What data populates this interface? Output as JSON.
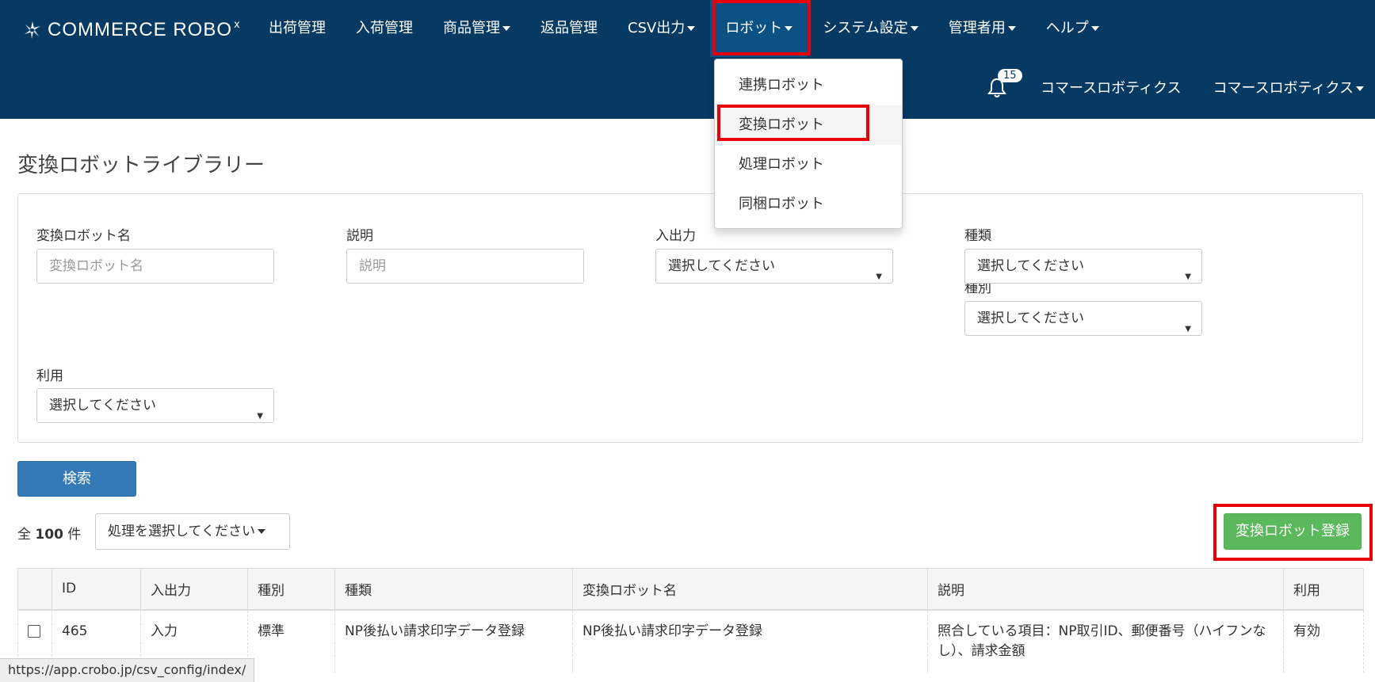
{
  "brand": {
    "logo_name": "COMMERCE ROBO",
    "logo_mark": "x"
  },
  "nav": [
    {
      "label": "出荷管理",
      "dropdown": false
    },
    {
      "label": "入荷管理",
      "dropdown": false
    },
    {
      "label": "商品管理",
      "dropdown": true
    },
    {
      "label": "返品管理",
      "dropdown": false
    },
    {
      "label": "CSV出力",
      "dropdown": true
    },
    {
      "label": "ロボット",
      "dropdown": true,
      "active": true
    },
    {
      "label": "システム設定",
      "dropdown": true
    },
    {
      "label": "管理者用",
      "dropdown": true
    },
    {
      "label": "ヘルプ",
      "dropdown": true
    }
  ],
  "header_right": {
    "notification_count": "15",
    "org_name": "コマースロボティクス",
    "user_name": "コマースロボティクス"
  },
  "robot_menu": {
    "items": [
      "連携ロボット",
      "変換ロボット",
      "処理ロボット",
      "同梱ロボット"
    ],
    "highlighted": "変換ロボット"
  },
  "page": {
    "title": "変換ロボットライブラリー"
  },
  "search": {
    "name_label": "変換ロボット名",
    "name_placeholder": "変換ロボット名",
    "desc_label": "説明",
    "desc_placeholder": "説明",
    "io_label": "入出力",
    "io_value": "選択してください",
    "kind_label": "種類",
    "kind_value": "選択してください",
    "category_label": "種別",
    "category_value": "選択してください",
    "usage_label": "利用",
    "usage_value": "選択してください",
    "search_button": "検索"
  },
  "list": {
    "total_prefix": "全",
    "total_count": "100",
    "total_suffix": "件",
    "bulk_action": "処理を選択してください",
    "register_button": "変換ロボット登録"
  },
  "table": {
    "headers": [
      "ID",
      "入出力",
      "種別",
      "種類",
      "変換ロボット名",
      "説明",
      "利用"
    ],
    "rows": [
      {
        "id": "465",
        "io": "入力",
        "category": "標準",
        "kind": "NP後払い請求印字データ登録",
        "name": "NP後払い請求印字データ登録",
        "description": "照合している項目：NP取引ID、郵便番号（ハイフンなし）、請求金額",
        "usage": "有効"
      }
    ]
  },
  "status_bar": {
    "url": "https://app.crobo.jp/csv_config/index/"
  },
  "colors": {
    "header_bg": "#063a63",
    "active_nav_bg": "#0b5184",
    "primary": "#337ab7",
    "success": "#5cb85c",
    "highlight_box": "#e8000b"
  }
}
